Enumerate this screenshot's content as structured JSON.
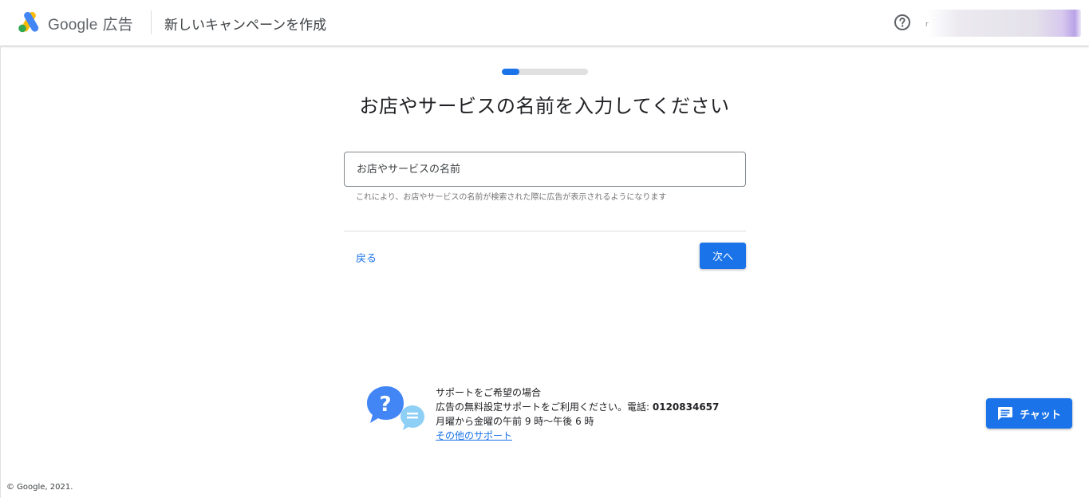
{
  "header": {
    "brand_name": "Google",
    "brand_suffix": "広告",
    "page_heading": "新しいキャンペーンを作成",
    "account_hint": "r"
  },
  "progress": {
    "fraction": 0.2
  },
  "main": {
    "title": "お店やサービスの名前を入力してください",
    "input_placeholder": "お店やサービスの名前",
    "input_value": "",
    "hint": "これにより、お店やサービスの名前が検索された際に広告が表示されるようになります",
    "back_label": "戻る",
    "next_label": "次へ"
  },
  "support": {
    "heading": "サポートをご希望の場合",
    "line2_prefix": "広告の無料設定サポートをご利用ください。電話: ",
    "phone": "0120834657",
    "hours": "月曜から金曜の午前 9 時～午後 6 時",
    "more_link": "その他のサポート"
  },
  "chat": {
    "label": "チャット"
  },
  "footer": {
    "copyright": "© Google, 2021."
  },
  "colors": {
    "accent": "#1a73e8"
  },
  "icons": [
    "google-ads-logo-icon",
    "help-icon",
    "support-question-icon",
    "chat-icon"
  ]
}
